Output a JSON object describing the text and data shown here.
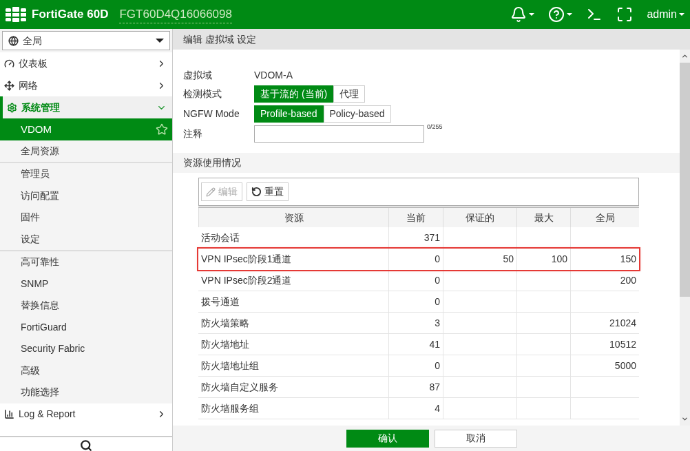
{
  "header": {
    "product": "FortiGate 60D",
    "serial": "FGT60D4Q16066098",
    "user": "admin"
  },
  "sidebar": {
    "scope": "全局",
    "items": [
      {
        "label": "仪表板",
        "expanded": false
      },
      {
        "label": "网络",
        "expanded": false
      },
      {
        "label": "系统管理",
        "expanded": true,
        "groups": [
          {
            "children": [
              {
                "label": "VDOM",
                "selected": true
              },
              {
                "label": "全局资源",
                "selected": false
              }
            ]
          },
          {
            "children": [
              {
                "label": "管理员",
                "selected": false
              },
              {
                "label": "访问配置",
                "selected": false
              },
              {
                "label": "固件",
                "selected": false
              },
              {
                "label": "设定",
                "selected": false
              }
            ]
          },
          {
            "children": [
              {
                "label": "高可靠性",
                "selected": false
              },
              {
                "label": "SNMP",
                "selected": false
              },
              {
                "label": "替换信息",
                "selected": false
              },
              {
                "label": "FortiGuard",
                "selected": false
              },
              {
                "label": "Security Fabric",
                "selected": false
              },
              {
                "label": "高级",
                "selected": false
              },
              {
                "label": "功能选择",
                "selected": false
              }
            ]
          }
        ]
      },
      {
        "label": "Log & Report",
        "expanded": false
      }
    ]
  },
  "page_title": "编辑 虚拟域 设定",
  "form": {
    "vdom_label": "虚拟域",
    "vdom_value": "VDOM-A",
    "inspection": {
      "label": "检测模式",
      "options": [
        {
          "label": "基于流的 (当前)",
          "selected": true
        },
        {
          "label": "代理",
          "selected": false
        }
      ]
    },
    "ngfw": {
      "label": "NGFW Mode",
      "options": [
        {
          "label": "Profile-based",
          "selected": true
        },
        {
          "label": "Policy-based",
          "selected": false
        }
      ]
    },
    "comment": {
      "label": "注释",
      "counter": "0/255"
    }
  },
  "resources": {
    "title": "资源使用情况",
    "edit_button": {
      "label": "编辑",
      "disabled": true
    },
    "reset_button": {
      "label": "重置",
      "disabled": false
    },
    "table": {
      "columns": [
        "资源",
        "当前",
        "保证的",
        "最大",
        "全局"
      ],
      "rows": [
        {
          "cells": [
            "活动会话",
            "371",
            "",
            "",
            ""
          ],
          "highlighted": false
        },
        {
          "cells": [
            "VPN IPsec阶段1通道",
            "0",
            "50",
            "100",
            "150"
          ],
          "highlighted": true
        },
        {
          "cells": [
            "VPN IPsec阶段2通道",
            "0",
            "",
            "",
            "200"
          ],
          "highlighted": false
        },
        {
          "cells": [
            "拨号通道",
            "0",
            "",
            "",
            ""
          ],
          "highlighted": false
        },
        {
          "cells": [
            "防火墙策略",
            "3",
            "",
            "",
            "21024"
          ],
          "highlighted": false
        },
        {
          "cells": [
            "防火墙地址",
            "41",
            "",
            "",
            "10512"
          ],
          "highlighted": false
        },
        {
          "cells": [
            "防火墙地址组",
            "0",
            "",
            "",
            "5000"
          ],
          "highlighted": false
        },
        {
          "cells": [
            "防火墙自定义服务",
            "87",
            "",
            "",
            ""
          ],
          "highlighted": false
        },
        {
          "cells": [
            "防火墙服务组",
            "4",
            "",
            "",
            ""
          ],
          "highlighted": false
        }
      ]
    }
  },
  "footer": {
    "ok": "确认",
    "cancel": "取消"
  }
}
